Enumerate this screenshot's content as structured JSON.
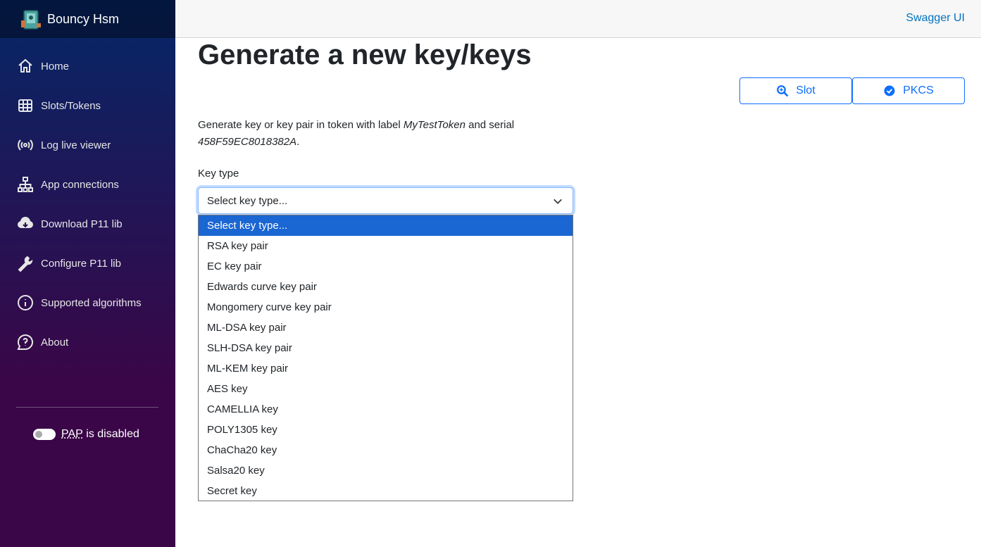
{
  "app": {
    "title": "Bouncy Hsm"
  },
  "topbar": {
    "swagger_link": "Swagger UI"
  },
  "nav": {
    "items": [
      {
        "label": "Home",
        "icon": "home-icon"
      },
      {
        "label": "Slots/Tokens",
        "icon": "chip-icon"
      },
      {
        "label": "Log live viewer",
        "icon": "broadcast-icon"
      },
      {
        "label": "App connections",
        "icon": "network-icon"
      },
      {
        "label": "Download P11 lib",
        "icon": "cloud-download-icon"
      },
      {
        "label": "Configure P11 lib",
        "icon": "wrench-icon"
      },
      {
        "label": "Supported algorithms",
        "icon": "info-icon"
      },
      {
        "label": "About",
        "icon": "question-icon"
      }
    ]
  },
  "pap": {
    "abbr": "PAP",
    "status_text": " is disabled",
    "enabled": false
  },
  "page": {
    "title": "Generate a new key/keys",
    "buttons": {
      "slot": "Slot",
      "pkcs": "PKCS"
    },
    "description": {
      "prefix": "Generate key or key pair in token with label ",
      "label": "MyTestToken",
      "middle": " and serial ",
      "serial": "458F59EC8018382A",
      "suffix": "."
    },
    "key_type_label": "Key type",
    "select_value": "Select key type...",
    "options": [
      "Select key type...",
      "RSA key pair",
      "EC key pair",
      "Edwards curve key pair",
      "Mongomery curve key pair",
      "ML-DSA key pair",
      "SLH-DSA key pair",
      "ML-KEM key pair",
      "AES key",
      "CAMELLIA key",
      "POLY1305 key",
      "ChaCha20 key",
      "Salsa20 key",
      "Secret key"
    ],
    "selected_index": 0
  },
  "colors": {
    "accent": "#0d6efd",
    "selected_option": "#1a66d2",
    "link": "#0071c1"
  }
}
